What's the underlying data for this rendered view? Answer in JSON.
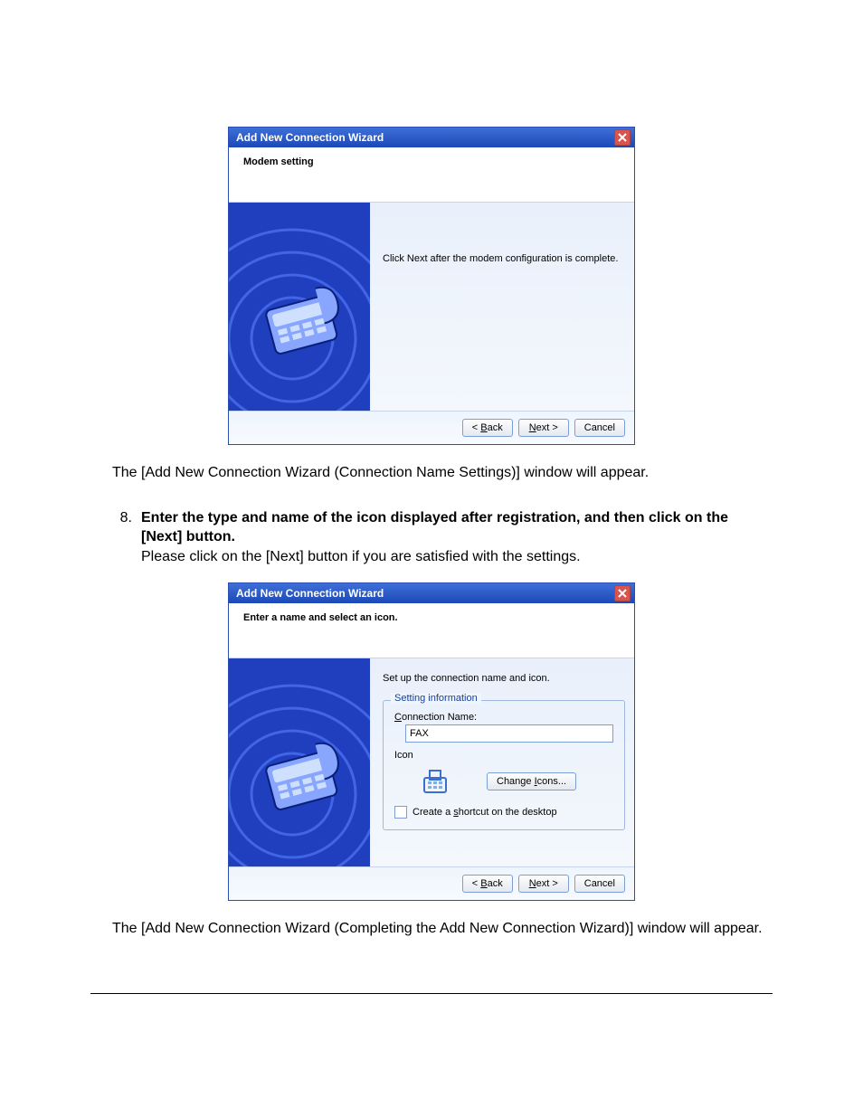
{
  "dialog1": {
    "title": "Add New Connection Wizard",
    "subhead": "Modem setting",
    "message": "Click Next after the modem configuration is complete.",
    "back": "< Back",
    "next": "Next >",
    "cancel": "Cancel"
  },
  "doc": {
    "after1": "The [Add New Connection Wizard (Connection Name Settings)] window will appear.",
    "step_num": "8.",
    "step_bold": "Enter the type and name of the icon displayed after registration, and then click on the [Next] button.",
    "step_plain": "Please click on the [Next] button if you are satisfied with the settings.",
    "after2": "The [Add New Connection Wizard (Completing the Add New Connection Wizard)] window will appear."
  },
  "dialog2": {
    "title": "Add New Connection Wizard",
    "subhead": "Enter a name and select an icon.",
    "intro": "Set up the connection name and icon.",
    "group": "Setting information",
    "conn_label": "Connection Name:",
    "conn_value": "FAX",
    "icon_label": "Icon",
    "change_icons": "Change Icons...",
    "shortcut": "Create a shortcut on the desktop",
    "back": "< Back",
    "next": "Next >",
    "cancel": "Cancel"
  }
}
